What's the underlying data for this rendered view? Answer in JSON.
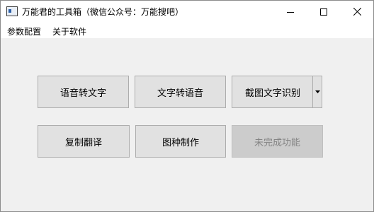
{
  "window": {
    "title": "万能君的工具箱（微信公众号：万能搜吧）",
    "controls": {
      "minimize": "minimize-icon",
      "maximize": "maximize-icon",
      "close": "close-icon"
    }
  },
  "menubar": {
    "items": [
      {
        "label": "参数配置"
      },
      {
        "label": "关于软件"
      }
    ]
  },
  "buttons": {
    "speech_to_text": "语音转文字",
    "text_to_speech": "文字转语音",
    "screenshot_ocr": "截图文字识别",
    "copy_translate": "复制翻译",
    "image_seed": "图种制作",
    "unfinished": "未完成功能"
  },
  "colors": {
    "window_bg": "#f0f0f0",
    "button_bg": "#e1e1e1",
    "button_border": "#adadad",
    "disabled_bg": "#cccccc",
    "disabled_text": "#838383"
  }
}
